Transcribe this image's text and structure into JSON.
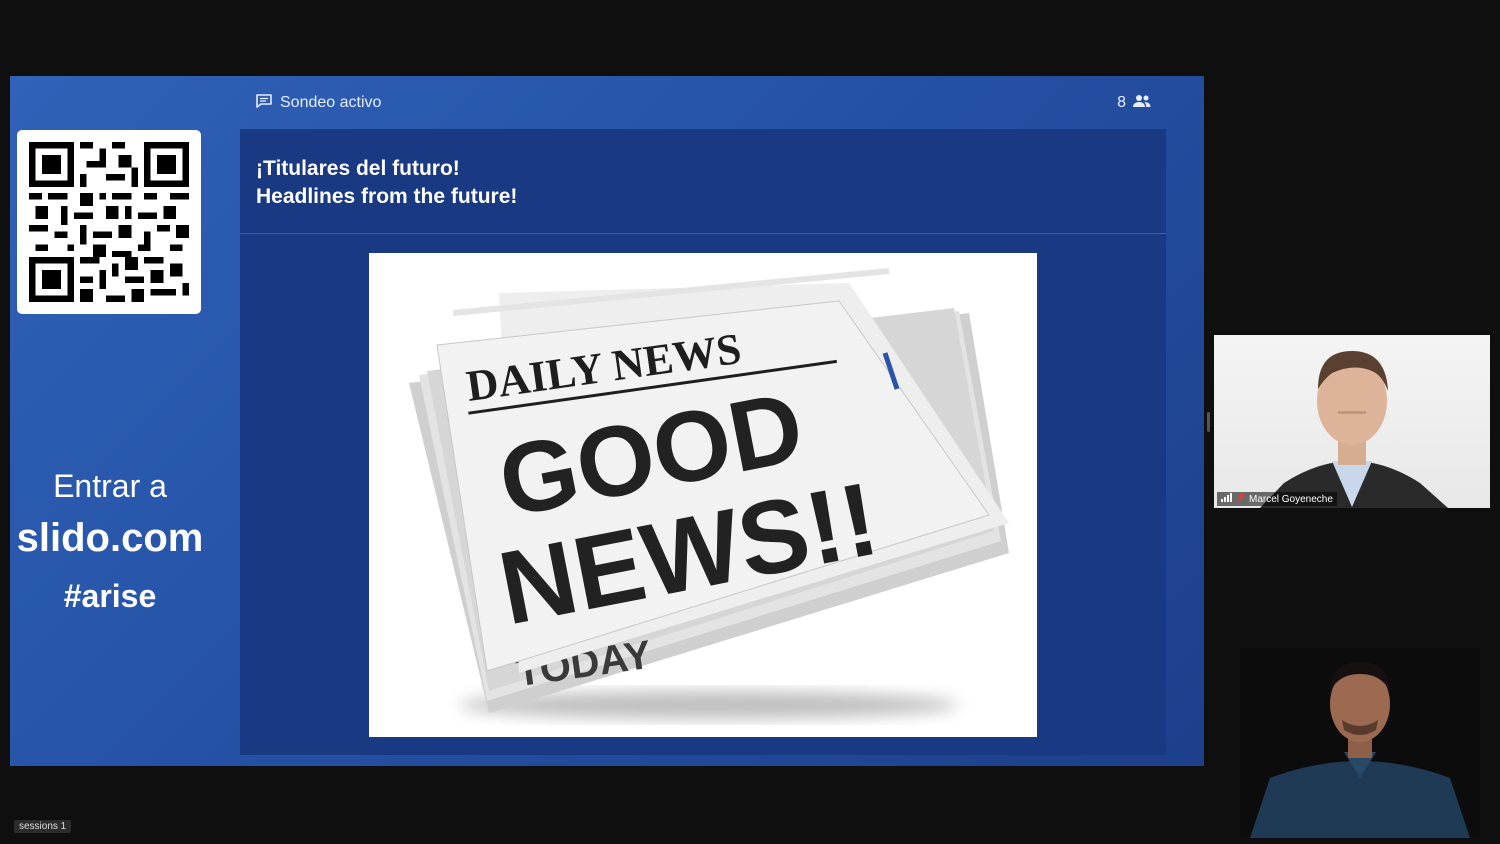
{
  "slido": {
    "poll_status": "Sondeo activo",
    "participant_count": "8",
    "question_line1": "¡Titulares del futuro!",
    "question_line2": "Headlines from the future!",
    "join_line1": "Entrar a",
    "join_line2": "slido.com",
    "join_line3": "#arise"
  },
  "image": {
    "masthead": "DAILY NEWS",
    "headline_line1": "GOOD",
    "headline_line2": "NEWS!!",
    "back_page_text": "TODAY"
  },
  "participants": [
    {
      "name": "Marcel Goyeneche"
    }
  ],
  "footer": {
    "sessions_label": "sessions 1"
  },
  "colors": {
    "slide_blue": "#2552a6",
    "card_blue": "#193a82",
    "background": "#0f0f0f"
  }
}
